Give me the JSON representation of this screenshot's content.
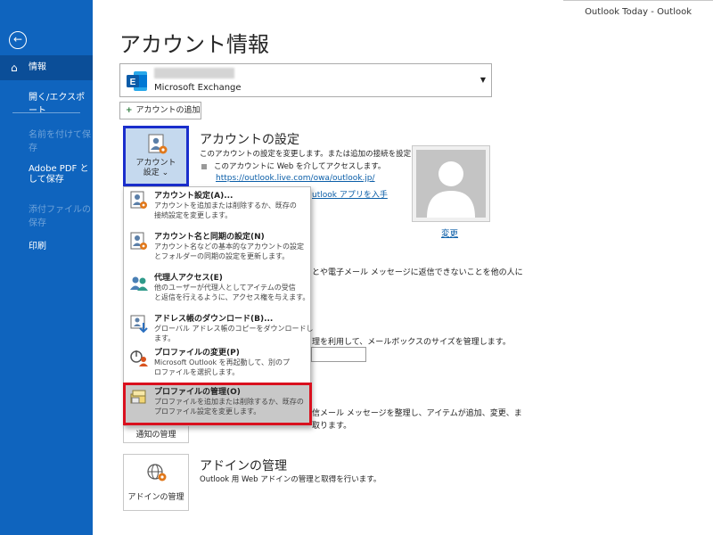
{
  "titlebar": {
    "text": "Outlook Today  -  Outlook"
  },
  "sidebar": {
    "back_glyph": "←",
    "items": [
      {
        "label": "情報",
        "icon": "home-icon",
        "selected": true
      },
      {
        "label": "開く/エクスポート"
      },
      {
        "label": "名前を付けて保存",
        "disabled": true
      },
      {
        "label": "Adobe PDF として保存"
      },
      {
        "label": "添付ファイルの保存",
        "disabled": true
      },
      {
        "label": "印刷"
      }
    ]
  },
  "page": {
    "title": "アカウント情報"
  },
  "account": {
    "type": "Microsoft Exchange",
    "dropdown_icon": "▼",
    "add_label": "アカウントの追加",
    "add_icon": "+"
  },
  "account_settings": {
    "button_label_line1": "アカウント",
    "button_label_line2": "設定 ⌄",
    "title": "アカウントの設定",
    "desc": "このアカウントの設定を変更します。または追加の接続を設定します。",
    "bullet": "このアカウントに Web を介してアクセスします。",
    "link": "https://outlook.live.com/owa/outlook.jp/",
    "link2": "utlook アプリを入手",
    "change_link": "変更"
  },
  "background_text": {
    "delegate_line1": "とや電子メール メッセージに返信できないことを他の人に",
    "delegate_line2": "",
    "mailbox": "理を利用して、メールボックスのサイズを管理します。",
    "rules_line1": "信メール メッセージを整理し、アイテムが追加、変更、ま",
    "rules_line2": "取ります。"
  },
  "notify_button": {
    "label": "通知の管理"
  },
  "addin": {
    "button_label": "アドインの管理",
    "title": "アドインの管理",
    "desc": "Outlook 用 Web アドインの管理と取得を行います。"
  },
  "menu": {
    "items": [
      {
        "title": "アカウント設定(A)...",
        "desc1": "アカウントを追加または削除するか、既存の",
        "desc2": "接続設定を変更します。",
        "icon": "account-settings-icon"
      },
      {
        "title": "アカウント名と同期の設定(N)",
        "desc1": "アカウント名などの基本的なアカウントの設定",
        "desc2": "とフォルダーの同期の設定を更新します。",
        "icon": "account-sync-icon"
      },
      {
        "title": "代理人アクセス(E)",
        "desc1": "他のユーザーが代理人としてアイテムの受信",
        "desc2": "と返信を行えるように、アクセス権を与えます。",
        "icon": "delegate-icon"
      },
      {
        "title": "アドレス帳のダウンロード(B)...",
        "desc1": "グローバル アドレス帳のコピーをダウンロードし",
        "desc2": "ます。",
        "icon": "address-book-download-icon"
      },
      {
        "title": "プロファイルの変更(P)",
        "desc1": "Microsoft Outlook を再起動して、別のプ",
        "desc2": "ロファイルを選択します。",
        "icon": "profile-change-icon"
      },
      {
        "title": "プロファイルの管理(O)",
        "desc1": "プロファイルを追加または削除するか、既存の",
        "desc2": "プロファイル設定を変更します。",
        "icon": "profile-manage-icon",
        "highlighted": true
      }
    ]
  },
  "colors": {
    "sidebar": "#0F64BE",
    "selected_border": "#1A2ECC",
    "highlight_frame": "#D9101E",
    "link": "#0B5EA8"
  }
}
